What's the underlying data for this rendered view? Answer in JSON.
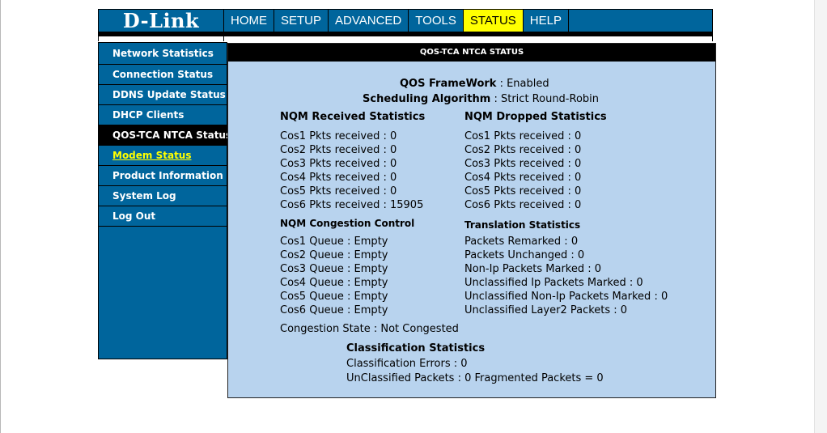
{
  "header": {
    "logo_text": "D-Link",
    "nav": [
      {
        "label": "HOME"
      },
      {
        "label": "SETUP"
      },
      {
        "label": "ADVANCED"
      },
      {
        "label": "TOOLS"
      },
      {
        "label": "STATUS",
        "active": true
      },
      {
        "label": "HELP"
      }
    ]
  },
  "sidebar": {
    "items": [
      {
        "label": "Network Statistics"
      },
      {
        "label": "Connection Status"
      },
      {
        "label": "DDNS Update Status"
      },
      {
        "label": "DHCP Clients"
      },
      {
        "label": "QOS-TCA NTCA Status",
        "active": true
      },
      {
        "label": "Modem Status"
      },
      {
        "label": "Product Information"
      },
      {
        "label": "System Log"
      },
      {
        "label": "Log Out"
      }
    ]
  },
  "panel": {
    "title": "QOS-TCA NTCA STATUS",
    "framework_label": "QOS FrameWork",
    "framework_value": " : Enabled",
    "scheduling_label": "Scheduling Algorithm",
    "scheduling_value": " : Strict Round-Robin",
    "received": {
      "heading": "NQM Received Statistics",
      "rows": [
        "Cos1 Pkts received : 0",
        "Cos2 Pkts received : 0",
        "Cos3 Pkts received : 0",
        "Cos4 Pkts received : 0",
        "Cos5 Pkts received : 0",
        "Cos6 Pkts received : 15905"
      ]
    },
    "dropped": {
      "heading": "NQM Dropped Statistics",
      "rows": [
        "Cos1 Pkts received : 0",
        "Cos2 Pkts received : 0",
        "Cos3 Pkts received : 0",
        "Cos4 Pkts received : 0",
        "Cos5 Pkts received : 0",
        "Cos6 Pkts received : 0"
      ]
    },
    "congestion": {
      "heading": "NQM Congestion Control",
      "rows": [
        "Cos1 Queue : Empty",
        "Cos2 Queue : Empty",
        "Cos3 Queue : Empty",
        "Cos4 Queue : Empty",
        "Cos5 Queue : Empty",
        "Cos6 Queue : Empty"
      ]
    },
    "translation": {
      "heading": "Translation Statistics",
      "rows": [
        "Packets Remarked : 0",
        "Packets Unchanged : 0",
        "Non-Ip Packets Marked : 0",
        "Unclassified Ip Packets Marked : 0",
        "Unclassified Non-Ip Packets Marked : 0",
        "Unclassified Layer2 Packets : 0"
      ]
    },
    "congestion_state": "Congestion State : Not Congested",
    "classification": {
      "heading": "Classification Statistics",
      "errors": "Classification Errors : 0",
      "unclassified": "UnClassified Packets : 0 Fragmented Packets = 0"
    }
  },
  "colors": {
    "brand_blue": "#00659c",
    "panel_bg": "#b8d3ee",
    "active_tab": "#ffff00"
  }
}
